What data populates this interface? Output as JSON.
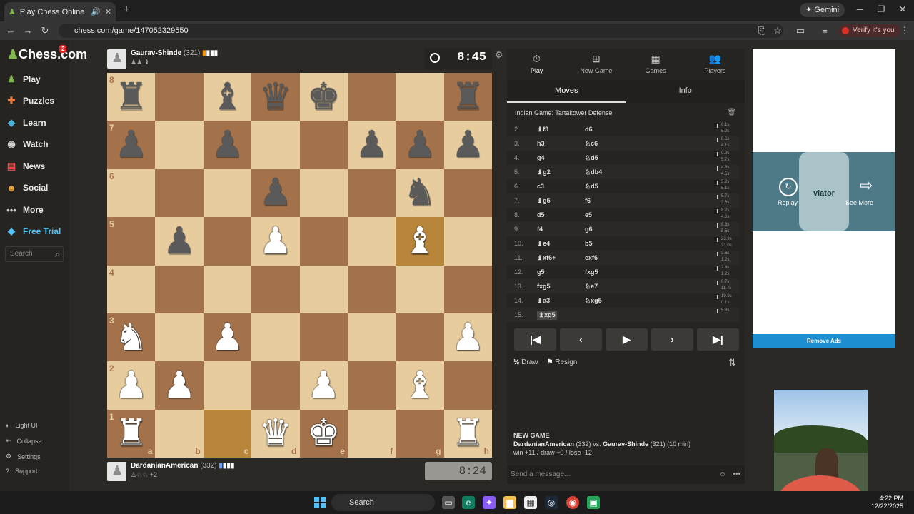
{
  "browser": {
    "tab_title": "Play Chess Online for FREE",
    "url": "chess.com/game/147052329550",
    "gemini_label": "Gemini",
    "verify_label": "Verify it's you"
  },
  "sidebar": {
    "logo": "Chess.com",
    "logo_badge": "2",
    "items": [
      {
        "label": "Play",
        "icon": "play-icon"
      },
      {
        "label": "Puzzles",
        "icon": "puzzle-icon"
      },
      {
        "label": "Learn",
        "icon": "learn-icon"
      },
      {
        "label": "Watch",
        "icon": "binoculars-icon"
      },
      {
        "label": "News",
        "icon": "news-icon"
      },
      {
        "label": "Social",
        "icon": "social-icon"
      },
      {
        "label": "More",
        "icon": "more-icon"
      },
      {
        "label": "Free Trial",
        "icon": "diamond-icon"
      }
    ],
    "search_placeholder": "Search",
    "bottom": [
      {
        "label": "Light UI"
      },
      {
        "label": "Collapse"
      },
      {
        "label": "Settings"
      },
      {
        "label": "Support"
      }
    ]
  },
  "opponent": {
    "name": "Gaurav-Shinde",
    "rating": "(321)",
    "clock": "8:45"
  },
  "player": {
    "name": "DardanianAmerican",
    "rating": "(332)",
    "captured_extra": "+2",
    "clock": "8:24"
  },
  "board": {
    "files": [
      "a",
      "b",
      "c",
      "d",
      "e",
      "f",
      "g",
      "h"
    ],
    "ranks": [
      "8",
      "7",
      "6",
      "5",
      "4",
      "3",
      "2",
      "1"
    ],
    "position": [
      [
        "bR",
        "",
        "bB",
        "bQ",
        "bK",
        "",
        "",
        "bR"
      ],
      [
        "bP",
        "",
        "bP",
        "",
        "",
        "bP",
        "bP",
        "bP"
      ],
      [
        "",
        "",
        "",
        "bP",
        "",
        "",
        "bN",
        ""
      ],
      [
        "",
        "bP",
        "",
        "wP",
        "",
        "",
        "wB",
        ""
      ],
      [
        "",
        "",
        "",
        "",
        "",
        "",
        "",
        ""
      ],
      [
        "wN",
        "",
        "wP",
        "",
        "",
        "",
        "",
        "wP"
      ],
      [
        "wP",
        "wP",
        "",
        "",
        "wP",
        "",
        "wB",
        ""
      ],
      [
        "wR",
        "",
        "",
        "wQ",
        "wK",
        "",
        "",
        "wR"
      ]
    ],
    "highlight": [
      "c1",
      "g5"
    ]
  },
  "panel": {
    "tabs": [
      {
        "label": "Play",
        "icon": "stopwatch-icon"
      },
      {
        "label": "New Game",
        "icon": "plus-icon"
      },
      {
        "label": "Games",
        "icon": "board-icon"
      },
      {
        "label": "Players",
        "icon": "players-icon"
      }
    ],
    "subtabs": [
      "Moves",
      "Info"
    ],
    "opening": "Indian Game: Tartakower Defense",
    "moves": [
      {
        "n": "2.",
        "w": "♝f3",
        "b": "d6",
        "tw": "0.1s",
        "tb": "5.2s"
      },
      {
        "n": "3.",
        "w": "h3",
        "b": "♘c6",
        "tw": "6.6s",
        "tb": "4.1s"
      },
      {
        "n": "4.",
        "w": "g4",
        "b": "♘d5",
        "tw": "0.9s",
        "tb": "5.7s"
      },
      {
        "n": "5.",
        "w": "♝g2",
        "b": "♘db4",
        "tw": "4.3s",
        "tb": "4.5s"
      },
      {
        "n": "6.",
        "w": "c3",
        "b": "♘d5",
        "tw": "5.2s",
        "tb": "5.1s"
      },
      {
        "n": "7.",
        "w": "♝g5",
        "b": "f6",
        "tw": "5.7s",
        "tb": "3.6s"
      },
      {
        "n": "8.",
        "w": "d5",
        "b": "e5",
        "tw": "8.2s",
        "tb": "4.6s"
      },
      {
        "n": "9.",
        "w": "f4",
        "b": "g6",
        "tw": "8.3s",
        "tb": "5.5s"
      },
      {
        "n": "10.",
        "w": "♝e4",
        "b": "b5",
        "tw": "23.9s",
        "tb": "21.0s"
      },
      {
        "n": "11.",
        "w": "♝xf6+",
        "b": "exf6",
        "tw": "3.6s",
        "tb": "1.2s"
      },
      {
        "n": "12.",
        "w": "g5",
        "b": "fxg5",
        "tw": "2.4s",
        "tb": "1.2s"
      },
      {
        "n": "13.",
        "w": "fxg5",
        "b": "♘e7",
        "tw": "0.7s",
        "tb": "11.7s"
      },
      {
        "n": "14.",
        "w": "♝a3",
        "b": "♘xg5",
        "tw": "19.9s",
        "tb": "0.1s"
      },
      {
        "n": "15.",
        "w": "♝xg5",
        "b": "",
        "tw": "5.3s",
        "tb": ""
      }
    ],
    "draw_label": "Draw",
    "resign_label": "Resign",
    "newgame_title": "NEW GAME",
    "newgame_white": "DardanianAmerican",
    "newgame_white_rating": "(332)",
    "newgame_vs": "vs.",
    "newgame_black": "Gaurav-Shinde",
    "newgame_black_rating": "(321) (10 min)",
    "record": "win +11 / draw +0 / lose -12",
    "message_placeholder": "Send a message..."
  },
  "ad": {
    "brand": "viator",
    "replay": "Replay",
    "see_more": "See More",
    "remove": "Remove Ads"
  },
  "taskbar": {
    "search": "Search",
    "time": "4:22 PM",
    "date": "12/22/2025"
  },
  "colors": {
    "light_square": "#e7cc9e",
    "dark_square": "#a4724a",
    "accent_green": "#81b64c",
    "remove_ads_blue": "#1d8fd1"
  }
}
